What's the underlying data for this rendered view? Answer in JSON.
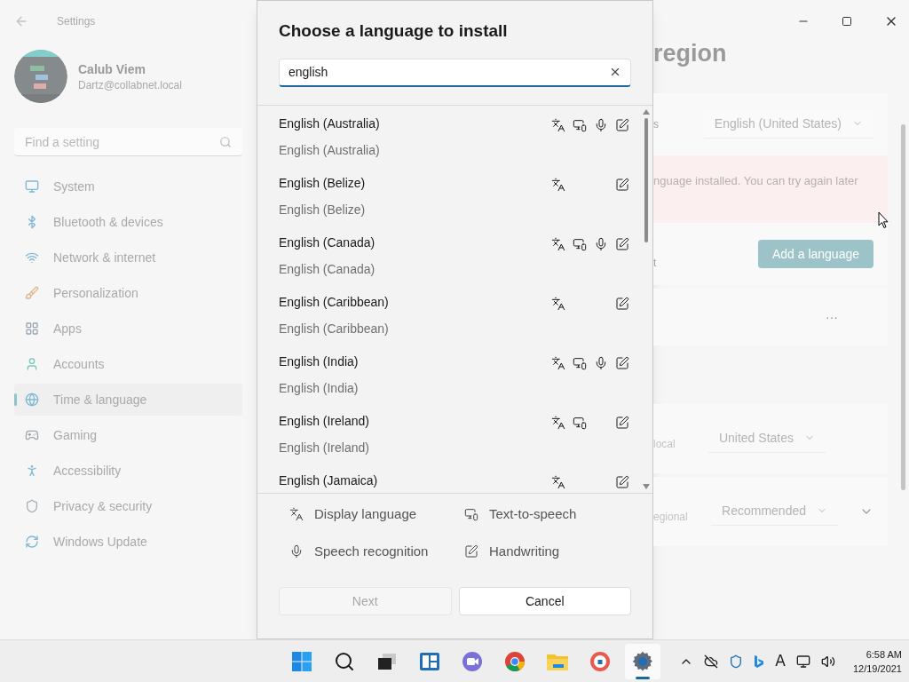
{
  "window": {
    "title": "Settings"
  },
  "account": {
    "name": "Calub Viem",
    "email": "Dartz@collabnet.local"
  },
  "sidebar": {
    "search": {
      "placeholder": "Find a setting"
    },
    "items": [
      {
        "label": "System",
        "selected": false
      },
      {
        "label": "Bluetooth & devices",
        "selected": false
      },
      {
        "label": "Network & internet",
        "selected": false
      },
      {
        "label": "Personalization",
        "selected": false
      },
      {
        "label": "Apps",
        "selected": false
      },
      {
        "label": "Accounts",
        "selected": false
      },
      {
        "label": "Time & language",
        "selected": true
      },
      {
        "label": "Gaming",
        "selected": false
      },
      {
        "label": "Accessibility",
        "selected": false
      },
      {
        "label": "Privacy & security",
        "selected": false
      },
      {
        "label": "Windows Update",
        "selected": false
      }
    ]
  },
  "background": {
    "title": "region",
    "preferred_fragment": "s",
    "display_language": "English (United States)",
    "error": "nguage installed. You can try again later",
    "add_fragment": "t",
    "add_button": "Add a language",
    "more": "···",
    "country_fragment": "local",
    "country": "United States",
    "format_fragment": "egional",
    "format": "Recommended"
  },
  "dialog": {
    "title": "Choose a language to install",
    "search": {
      "value": "english"
    },
    "languages": [
      {
        "name": "English (Australia)",
        "native": "English (Australia)",
        "display": true,
        "tts": true,
        "speech": true,
        "handwriting": true
      },
      {
        "name": "English (Belize)",
        "native": "English (Belize)",
        "display": true,
        "tts": false,
        "speech": false,
        "handwriting": true
      },
      {
        "name": "English (Canada)",
        "native": "English (Canada)",
        "display": true,
        "tts": true,
        "speech": true,
        "handwriting": true
      },
      {
        "name": "English (Caribbean)",
        "native": "English (Caribbean)",
        "display": true,
        "tts": false,
        "speech": false,
        "handwriting": true
      },
      {
        "name": "English (India)",
        "native": "English (India)",
        "display": true,
        "tts": true,
        "speech": true,
        "handwriting": true
      },
      {
        "name": "English (Ireland)",
        "native": "English (Ireland)",
        "display": true,
        "tts": true,
        "speech": false,
        "handwriting": true
      },
      {
        "name": "English (Jamaica)",
        "display": true,
        "tts": false,
        "speech": false,
        "handwriting": true
      }
    ],
    "legend": [
      {
        "kind": "display",
        "label": "Display language"
      },
      {
        "kind": "tts",
        "label": "Text-to-speech"
      },
      {
        "kind": "speech",
        "label": "Speech recognition"
      },
      {
        "kind": "handwriting",
        "label": "Handwriting"
      }
    ],
    "buttons": [
      {
        "label": "Next",
        "disabled": true
      },
      {
        "label": "Cancel",
        "disabled": false
      }
    ]
  },
  "taskbar": {
    "apps": [
      {
        "kind": "start",
        "active": false
      },
      {
        "kind": "search",
        "active": false
      },
      {
        "kind": "taskview",
        "active": false
      },
      {
        "kind": "widgets",
        "active": false
      },
      {
        "kind": "chat",
        "active": false
      },
      {
        "kind": "chrome",
        "active": false
      },
      {
        "kind": "explorer",
        "active": false
      },
      {
        "kind": "vpn",
        "active": false
      },
      {
        "kind": "settings",
        "active": true
      }
    ],
    "tray_letter": "A",
    "time": "6:58 AM",
    "date": "12/19/2021"
  }
}
